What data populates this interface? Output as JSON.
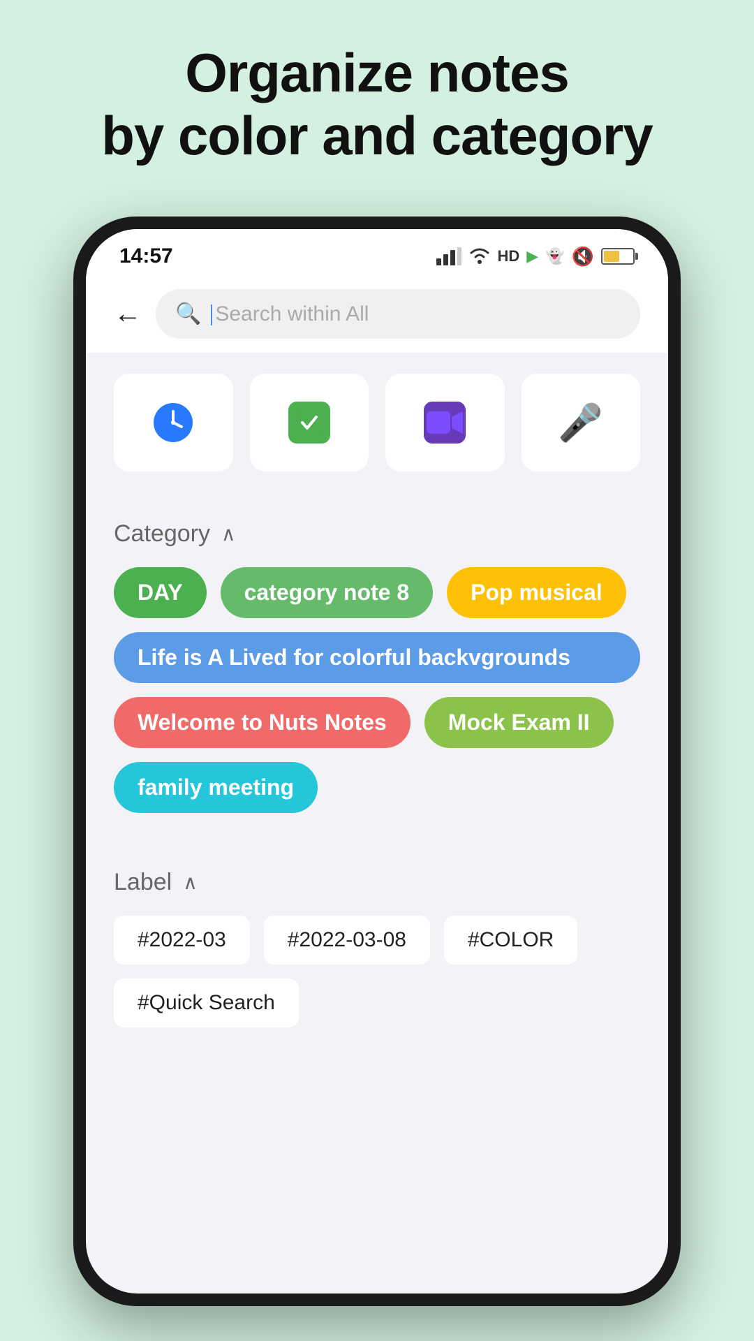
{
  "header": {
    "line1": "Organize notes",
    "line2": "by color and category"
  },
  "statusBar": {
    "time": "14:57",
    "icons": "4G WiFi HD ▶ SnapChat"
  },
  "search": {
    "placeholder": "Search within All"
  },
  "backButton": "←",
  "quickIcons": [
    {
      "name": "clock",
      "type": "clock"
    },
    {
      "name": "task",
      "type": "task"
    },
    {
      "name": "video",
      "type": "video"
    },
    {
      "name": "mic",
      "type": "mic"
    }
  ],
  "categorySection": {
    "title": "Category",
    "tags": [
      {
        "label": "DAY",
        "color": "tag-green"
      },
      {
        "label": "category note 8",
        "color": "tag-green2"
      },
      {
        "label": "Pop musical",
        "color": "tag-yellow"
      },
      {
        "label": "Life is A Lived for colorful backvgrounds",
        "color": "tag-blue"
      },
      {
        "label": "Welcome to Nuts Notes",
        "color": "tag-coral"
      },
      {
        "label": "Mock Exam II",
        "color": "tag-lime"
      },
      {
        "label": "family meeting",
        "color": "tag-cyan"
      }
    ]
  },
  "labelSection": {
    "title": "Label",
    "tags": [
      {
        "label": "#2022-03"
      },
      {
        "label": "#2022-03-08"
      },
      {
        "label": "#COLOR"
      },
      {
        "label": "#Quick Search"
      }
    ]
  }
}
